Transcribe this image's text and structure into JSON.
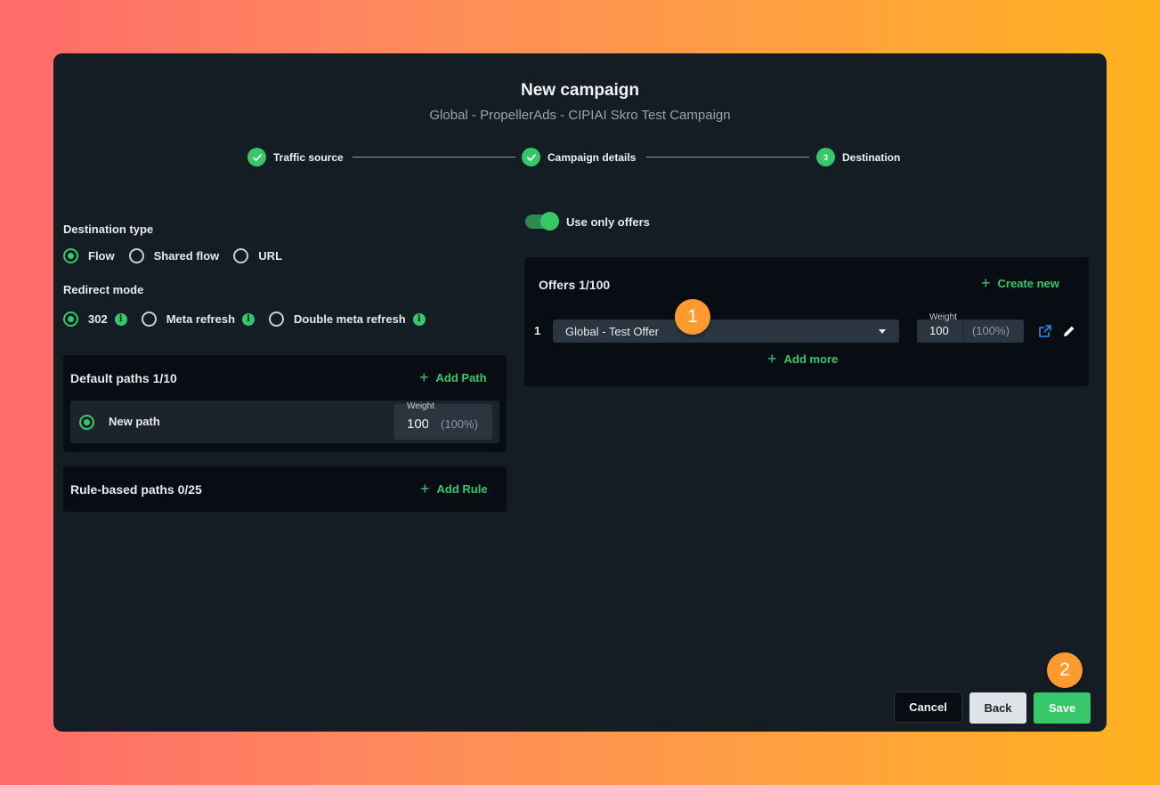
{
  "header": {
    "title": "New campaign",
    "subtitle": "Global - PropellerAds - CIPIAI Skro Test Campaign"
  },
  "stepper": {
    "steps": [
      {
        "label": "Traffic source",
        "state": "done"
      },
      {
        "label": "Campaign details",
        "state": "done"
      },
      {
        "label": "Destination",
        "state": "current",
        "number": "3"
      }
    ]
  },
  "destination": {
    "type_label": "Destination type",
    "type_options": [
      "Flow",
      "Shared flow",
      "URL"
    ],
    "type_selected": "Flow",
    "redirect_label": "Redirect mode",
    "redirect_options": [
      "302",
      "Meta refresh",
      "Double meta refresh"
    ],
    "redirect_selected": "302"
  },
  "default_paths": {
    "title": "Default paths 1/10",
    "add_label": "Add Path",
    "path_name": "New path",
    "weight_label": "Weight",
    "weight_value": "100",
    "weight_percent": "(100%)"
  },
  "rule_paths": {
    "title": "Rule-based paths 0/25",
    "add_label": "Add Rule"
  },
  "offers": {
    "toggle_label": "Use only offers",
    "toggle_on": true,
    "title": "Offers 1/100",
    "create_label": "Create new",
    "row_index": "1",
    "selected_offer": "Global - Test Offer",
    "weight_label": "Weight",
    "weight_value": "100",
    "weight_percent": "(100%)",
    "add_more_label": "Add more"
  },
  "badges": {
    "one": "1",
    "two": "2"
  },
  "footer": {
    "cancel": "Cancel",
    "back": "Back",
    "save": "Save"
  },
  "colors": {
    "accent": "#38c768",
    "badge": "#ff9a2e",
    "modal_bg": "#141c24",
    "panel_bg": "#070d12"
  }
}
